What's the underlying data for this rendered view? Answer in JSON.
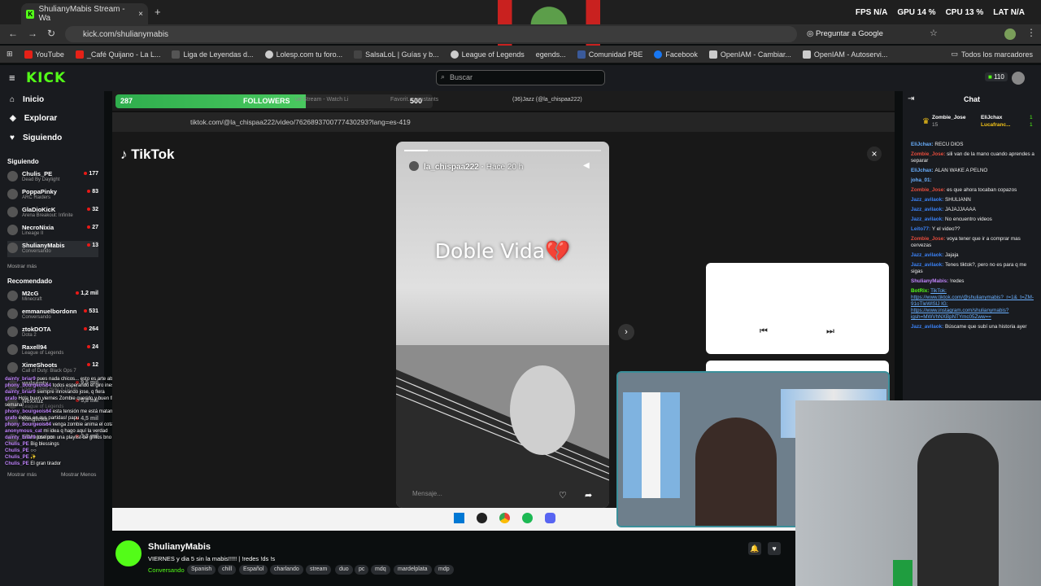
{
  "browser": {
    "tab_title": "ShulianyMabis Stream - Wa",
    "url": "kick.com/shulianymabis",
    "bookmarks": [
      "YouTube",
      "_Café Quijano - La L...",
      "Liga de Leyendas d...",
      "Lolesp.com tu foro...",
      "SalsaLoL | Guías y b...",
      "League of Legends",
      "Comunidad PBE",
      "Facebook",
      "OpenIAM - Cambiar...",
      "OpenIAM - Autoservi..."
    ],
    "bookmark_frag": "egends...",
    "all_bookmarks": "Todos los marcadores",
    "ask_google": "Preguntar a Google"
  },
  "hud": {
    "fps_label": "FPS",
    "fps": "N/A",
    "gpu_label": "GPU",
    "gpu": "14 %",
    "cpu_label": "CPU",
    "cpu": "13 %",
    "lat_label": "LAT",
    "lat": "N/A"
  },
  "kick": {
    "logo": "KICK",
    "search_placeholder": "Buscar",
    "kicks": "110",
    "nav": [
      "Inicio",
      "Explorar",
      "Siguiendo"
    ]
  },
  "sidebar": {
    "following_title": "Siguiendo",
    "following": [
      {
        "name": "Chulis_PE",
        "game": "Dead By Daylight",
        "viewers": "177"
      },
      {
        "name": "PoppaPinky",
        "game": "ARC Raiders",
        "viewers": "83"
      },
      {
        "name": "GlaDioKicK",
        "game": "Arena Breakout: Infinite",
        "viewers": "32"
      },
      {
        "name": "NecroNixia",
        "game": "Lineage II",
        "viewers": "27"
      },
      {
        "name": "ShulianyMabis",
        "game": "Conversando",
        "viewers": "13"
      }
    ],
    "show_more": "Mostrar más",
    "recommended_title": "Recomendado",
    "recommended": [
      {
        "name": "M2cG",
        "game": "Minecraft",
        "viewers": "1,2 mil"
      },
      {
        "name": "emmanuelbordonn",
        "game": "Conversando",
        "viewers": "531"
      },
      {
        "name": "ztokDOTA",
        "game": "Dota 2",
        "viewers": "264"
      },
      {
        "name": "Raxell94",
        "game": "League of Legends",
        "viewers": "24"
      },
      {
        "name": "XimeShoots",
        "game": "Call of Duty: Black Ops 7",
        "viewers": "12"
      },
      {
        "name": "wulsenty",
        "game": "Grand Theft Auto V (GTA)",
        "viewers": "9,5 mil"
      },
      {
        "name": "Nexxuz",
        "game": "League of Legends",
        "viewers": "5,8 mil"
      },
      {
        "name": "Kingteka",
        "game": "Conversando",
        "viewers": "4,5 mil"
      },
      {
        "name": "ElMacarius",
        "game": "",
        "viewers": "3,3 mil"
      }
    ],
    "show_more2": "Mostrar más",
    "show_less": "Mostrar Menos"
  },
  "overlay_chat": [
    {
      "user": "dainty_briar9",
      "text": "pues nada chicos... esto es arte abstracto"
    },
    {
      "user": "phony_bourgeois64",
      "text": "todos esperando el giro inesperado macho"
    },
    {
      "user": "dainty_briar9",
      "text": "siempre innovando jose, q flera"
    },
    {
      "user": "grafo",
      "text": "Hola buen viernes Zombie querido y buen finde fin de semana!"
    },
    {
      "user": "phony_bourgeois64",
      "text": "esta tensión me está matando tio"
    },
    {
      "user": "grafo",
      "text": "éxitos en sus partidas! papu"
    },
    {
      "user": "phony_bourgeois64",
      "text": "venga zombie anima el cotarro ya"
    },
    {
      "user": "anonymous_cat",
      "text": "mi idea q hago aquí la verdad"
    },
    {
      "user": "dainty_briar9",
      "text": "jose pon una playlist de grillos bno"
    },
    {
      "user": "Chulis_PE",
      "text": "Big blessings"
    },
    {
      "user": "Chulis_PE",
      "text": "○○"
    },
    {
      "user": "Chulis_PE",
      "text": "✨"
    },
    {
      "user": "Chulis_PE",
      "text": "El gran tirador"
    }
  ],
  "stream": {
    "followers_current": "287",
    "followers_label": "FOLLOWERS",
    "followers_goal": "500",
    "followers_progress": 0.57,
    "inner_tab1": "ue Stream - Watch Li",
    "inner_tab2": "Favorit... constants",
    "inner_tab3": "(36)Jazz (@la_chispaa222)",
    "inner_url": "tiktok.com/@la_chispaa222/video/7626893700777430293?lang=es-419",
    "tiktok_logo": "TikTok",
    "video_user": "la_chispaa222",
    "video_time": "Hace 20 h",
    "video_title": "Doble Vida",
    "video_emoji": "💔",
    "msg_placeholder": "Mensaje..."
  },
  "info": {
    "name": "ShulianyMabis",
    "title": "VIERNES y dia 5 sin la mabis!!!!! | !redes !ds !s",
    "category": "Conversando",
    "tags": [
      "Spanish",
      "chill",
      "Español",
      "charlando",
      "stream",
      "duo",
      "pc",
      "mdq",
      "mardelplata",
      "mdp"
    ]
  },
  "chat": {
    "title": "Chat",
    "pinned": [
      {
        "user": "Zombie_Jose",
        "count": "15"
      },
      {
        "user": "EliJchax",
        "count": "1"
      },
      {
        "user": "Lucafranc...",
        "count": "1"
      }
    ],
    "messages": [
      {
        "user": "EliJchax",
        "text": "RECU DIOS",
        "color": "#6ab0ff"
      },
      {
        "user": "Zombie_Jose",
        "text": "sili van de la mano cuando aprendes a separar",
        "color": "#e74c3c"
      },
      {
        "user": "EliJchax",
        "text": "ALAN WAKE A PELNO",
        "color": "#6ab0ff"
      },
      {
        "user": "joha_01",
        "text": "",
        "color": "#6ab0ff"
      },
      {
        "user": "Zombie_Jose",
        "text": "es que ahora tocaban copazos",
        "color": "#e74c3c"
      },
      {
        "user": "Jazz_avilaok",
        "text": "SHULIANN",
        "color": "#3b82f6"
      },
      {
        "user": "Jazz_avilaok",
        "text": "JAJAJJAAAA",
        "color": "#3b82f6"
      },
      {
        "user": "Jazz_avilaok",
        "text": "No encuentro videos",
        "color": "#3b82f6"
      },
      {
        "user": "Leito77",
        "text": "Y el video??",
        "color": "#3b82f6"
      },
      {
        "user": "Zombie_Jose",
        "text": "voya tener que ir a comprar mas cervezas",
        "color": "#e74c3c"
      },
      {
        "user": "Jazz_avilaok",
        "text": "Jajaja",
        "color": "#3b82f6"
      },
      {
        "user": "Jazz_avilaok",
        "text": "Tenes tiktok?, pero no es para q me sigas",
        "color": "#3b82f6"
      },
      {
        "user": "ShulianyMabis",
        "text": "!redes",
        "color": "#c084fc"
      },
      {
        "user": "BotRix",
        "text": "TikTok: https://www.tiktok.com/@shulianymabis?_r=1&_t=ZM-91oTleWlSlJ IG: https://www.instagram.com/shulianymabis?igsh=MWVhNXBpNTYmc05Zww==",
        "color": "#53fc18"
      },
      {
        "user": "Jazz_avilaok",
        "text": "Búscame que subí una historia ayer",
        "color": "#3b82f6"
      }
    ]
  },
  "colors": {
    "kick_green": "#53fc18",
    "bg": "#0b0e0f",
    "panel": "#191b1f"
  }
}
